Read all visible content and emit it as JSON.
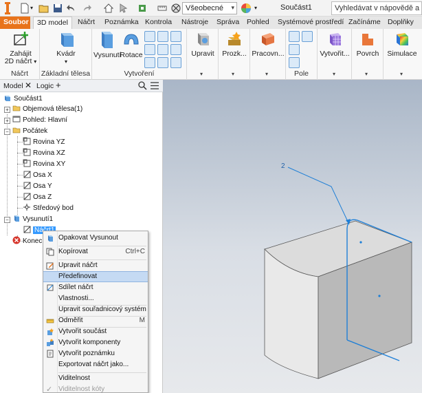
{
  "qat": {
    "style_value": "Všeobecné",
    "doc_title": "Součást1",
    "help_search_placeholder": "Vyhledávat v nápovědě a přík"
  },
  "tabs": [
    {
      "label": "Soubor"
    },
    {
      "label": "3D model"
    },
    {
      "label": "Náčrt"
    },
    {
      "label": "Poznámka"
    },
    {
      "label": "Kontrola"
    },
    {
      "label": "Nástroje"
    },
    {
      "label": "Správa"
    },
    {
      "label": "Pohled"
    },
    {
      "label": "Systémové prostředí"
    },
    {
      "label": "Začínáme"
    },
    {
      "label": "Doplňky"
    }
  ],
  "ribbon": {
    "nacrt": {
      "btn_line1": "Zahájit",
      "btn_line2": "2D náčrt",
      "label": "Náčrt"
    },
    "zakladni": {
      "btn": "Kvádr",
      "label": "Základní tělesa"
    },
    "vytvoreni": {
      "btn1": "Vysunutí",
      "btn2": "Rotace",
      "label": "Vytvoření"
    },
    "upravit": {
      "btn": "Upravit"
    },
    "prozk": {
      "btn": "Prozk..."
    },
    "pracovni": {
      "btn": "Pracovn..."
    },
    "pole": {
      "label": "Pole"
    },
    "vytvorit": {
      "btn": "Vytvořit..."
    },
    "povrch": {
      "btn": "Povrch"
    },
    "simulace": {
      "btn": "Simulace"
    }
  },
  "browser": {
    "tab_model": "Model",
    "tab_logic": "Logic",
    "nodes": {
      "root": "Součást1",
      "bodies": "Objemová tělesa(1)",
      "view": "Pohled: Hlavní",
      "origin": "Počátek",
      "plane_yz": "Rovina YZ",
      "plane_xz": "Rovina XZ",
      "plane_xy": "Rovina XY",
      "axis_x": "Osa X",
      "axis_y": "Osa Y",
      "axis_z": "Osa Z",
      "center": "Středový bod",
      "extrude": "Vysunutí1",
      "sketch": "Náčrt1",
      "end": "Konec součásti"
    }
  },
  "context_menu": [
    {
      "label": "Opakovat Vysunout",
      "icon": "extrude-icon"
    },
    {
      "label": "Kopírovat",
      "shortcut": "Ctrl+C",
      "icon": "copy-icon"
    },
    {
      "label": "Upravit náčrt",
      "icon": "edit-sketch-icon"
    },
    {
      "label": "Předefinovat"
    },
    {
      "label": "Sdílet náčrt",
      "icon": "share-sketch-icon"
    },
    {
      "label": "Vlastnosti..."
    },
    {
      "label": "Upravit souřadnicový systém"
    },
    {
      "label": "Odměřit",
      "shortcut": "M",
      "icon": "measure-icon"
    },
    {
      "label": "Vytvořit součást",
      "icon": "create-part-icon"
    },
    {
      "label": "Vytvořit komponenty",
      "icon": "create-components-icon"
    },
    {
      "label": "Vytvořit poznámku",
      "icon": "create-note-icon"
    },
    {
      "label": "Exportovat náčrt jako..."
    },
    {
      "label": "Viditelnost"
    },
    {
      "label": "Viditelnost kóty"
    }
  ],
  "viewport": {
    "callout_label": "2"
  }
}
